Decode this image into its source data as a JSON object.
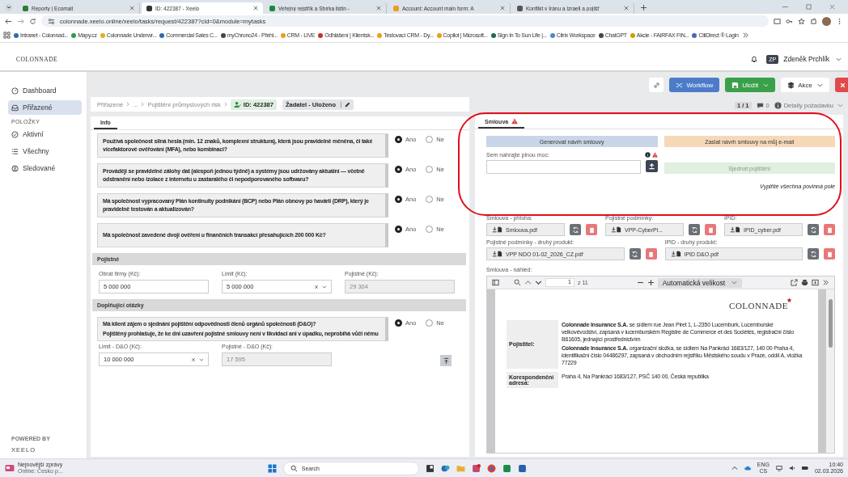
{
  "browser": {
    "tabs": [
      {
        "title": "Reporty | Ecomail",
        "color": "#2e7d32",
        "selected": false
      },
      {
        "title": "ID: 422387 - Xeelo",
        "color": "#333333",
        "selected": true
      },
      {
        "title": "Veřejný rejstřík a Sbírka listin - ",
        "color": "#1b8a3a",
        "selected": false
      },
      {
        "title": "Account: Account main form: A",
        "color": "#e8a020",
        "selected": false
      },
      {
        "title": "Konflikt v Íránu a Izraeli a pojišť",
        "color": "#555555",
        "selected": false
      }
    ],
    "url": "colonnade.xeelo.online/xeelo/tasks/request/422387?cid=0&module=mytasks",
    "bookmarks": [
      {
        "label": "Intranet - Colonnad...",
        "color": "#2a6db0"
      },
      {
        "label": "Mapy.cz",
        "color": "#2e9e4a"
      },
      {
        "label": "Colonnade Underwr...",
        "color": "#e0b020"
      },
      {
        "label": "Commercial Sales C...",
        "color": "#2a6db0"
      },
      {
        "label": "myChrono24 - Přehl...",
        "color": "#444444"
      },
      {
        "label": "CRM - LIVE",
        "color": "#e8a020"
      },
      {
        "label": "Odhlášení | Klientsk...",
        "color": "#c03030"
      },
      {
        "label": "Testovací CRM - Dy...",
        "color": "#e8a020"
      },
      {
        "label": "Copilot | Microsoft...",
        "color": "#e8a020"
      },
      {
        "label": "Sign In To Sun Life |...",
        "color": "#1a6a5a"
      },
      {
        "label": "Citrix Workspace",
        "color": "#4a8ad0"
      },
      {
        "label": "ChatGPT",
        "color": "#444444"
      },
      {
        "label": "Akcie - FAIRFAX FIN...",
        "color": "#c8a000"
      },
      {
        "label": "CitiDirect ® Login",
        "color": "#4a6ab0"
      }
    ]
  },
  "header": {
    "logo": "COLONNADE",
    "user_initials": "ZP",
    "user_name": "Zdeněk Prchlík"
  },
  "sidebar": {
    "items": [
      {
        "label": "Dashboard",
        "kind": "dashboard",
        "selected": false
      },
      {
        "label": "Přiřazené",
        "kind": "inbox",
        "selected": true
      }
    ],
    "section": "POLOŽKY",
    "section_items": [
      {
        "label": "Aktivní",
        "kind": "check",
        "selected": false
      },
      {
        "label": "Všechny",
        "kind": "list",
        "selected": false
      },
      {
        "label": "Sledované",
        "kind": "user",
        "selected": false
      }
    ],
    "powered_by": "POWERED BY",
    "brand": "XEELO"
  },
  "toolbar": {
    "buttons": [
      {
        "label": "Workflow",
        "kind": "workflow"
      },
      {
        "label": "Uložit",
        "kind": "save"
      },
      {
        "label": "Akce",
        "kind": "actions"
      }
    ]
  },
  "breadcrumb": {
    "items": [
      "Přiřazené",
      "...",
      "Pojištění průmyslových risk"
    ],
    "id": "ID: 422387",
    "status": "Žadatel - Uloženo"
  },
  "left_panel": {
    "tabs": [
      {
        "label": "Info",
        "selected": true
      }
    ],
    "questions": [
      {
        "paragraphs": [
          "Používá společnost silná hesla (min. 12 znaků, komplexní struktura), která jsou pravidelně měněna, či také vícefaktorové ověřování (MFA), nebo kombinaci?"
        ],
        "options": [
          {
            "label": "Ano",
            "selected": true
          },
          {
            "label": "Ne",
            "selected": false
          }
        ]
      },
      {
        "paragraphs": [
          "Provádějí se pravidelné zálohy dat (alespoň jednou týdně) a systémy jsou udržovány aktuální — včetně odstranění nebo izolace z internetu u zastaralého či nepodporovaného softwaru?"
        ],
        "options": [
          {
            "label": "Ano",
            "selected": true
          },
          {
            "label": "Ne",
            "selected": false
          }
        ]
      },
      {
        "paragraphs": [
          "Má společnost vypracovaný Plán kontinuity podnikání (BCP) nebo Plán obnovy po havárii (DRP), který je pravidelně testován a aktualizován?"
        ],
        "options": [
          {
            "label": "Ano",
            "selected": true
          },
          {
            "label": "Ne",
            "selected": false
          }
        ]
      },
      {
        "paragraphs": [
          "Má společnost zavedené dvojí ověření u finančních transakcí přesahujících 200 000 Kč?"
        ],
        "options": [
          {
            "label": "Ano",
            "selected": true
          },
          {
            "label": "Ne",
            "selected": false
          }
        ]
      }
    ],
    "premium": {
      "title": "Pojistné",
      "fields": [
        {
          "label": "Obrat firmy (Kč):",
          "value": "5 000 000",
          "kind": "input"
        },
        {
          "label": "Limit (Kč):",
          "value": "5 000 000",
          "kind": "select"
        },
        {
          "label": "Pojistné (Kč):",
          "value": "29 304",
          "kind": "readonly"
        }
      ]
    },
    "additional": {
      "title": "Doplňující otázky",
      "questions": [
        {
          "paragraphs": [
            "Má klient zájem o sjednání pojištění odpovědnosti členů orgánů společnosti (D&O)?",
            "Pojištěný prohlašuje, že ke dni uzavření pojistné smlouvy není v likvidaci ani v úpadku, neprobíhá vůči němu"
          ],
          "options": [
            {
              "label": "Ano",
              "selected": true
            },
            {
              "label": "Ne",
              "selected": false
            }
          ]
        }
      ],
      "fields": [
        {
          "label": "Limit - D&O (Kč):",
          "value": "10 000 000",
          "kind": "select"
        },
        {
          "label": "Pojistné - D&O (Kč):",
          "value": "17 595",
          "kind": "readonly"
        }
      ]
    }
  },
  "right_panel": {
    "counter": "1 / 1",
    "comments": "0",
    "details": "Detaily požadavku",
    "tabs": [
      {
        "label": "Smlouva",
        "warning": true,
        "selected": true
      }
    ],
    "generate": "Generovat návrh smlouvy",
    "send": "Zaslat návrh smlouvy na můj e-mail",
    "upload_label": "Sem nahrajte plnou moc:",
    "submit": {
      "label": "Sjednat pojištění",
      "disabled": true
    },
    "hint": "Vyplňte všechna povinná pole",
    "attachment_rows": [
      [
        {
          "label": "Smlouva - příloha:",
          "file": "Smlouva.pdf"
        },
        {
          "label": "Pojistné podmínky:",
          "file": "VPP-CyberPl..."
        },
        {
          "label": "IPID:",
          "file": "IPID_cyber.pdf"
        }
      ],
      [
        {
          "label": "Pojistné podmínky - druhý produkt:",
          "file": "VPP NDO 01-02_2026_CZ.pdf"
        },
        {
          "label": "IPID - druhý produkt:",
          "file": "IPID D&O.pdf"
        }
      ]
    ],
    "preview": {
      "label": "Smlouva - náhled:",
      "page": "1",
      "pages": "z 11",
      "zoom": "Automatická velikost",
      "logo": "COLONNADE",
      "rows": [
        {
          "label": "Pojistitel:",
          "paragraphs": [
            "**Colonnade Insurance S.A.** se sídlem rue Jean Piret 1, L-2350 Lucemburk, Lucemburské velkovévodství, zapsaná v lucemburském Registre de Commerce et des Sociétés, registrační číslo B61605, jednající prostřednictvím",
            "**Colonnade Insurance S.A.** organizační složka, se sídlem Na Pankráci 1683/127, 140 00 Praha 4, identifikační číslo 04486297, zapsaná v obchodním rejstříku Městského soudu v Praze, oddíl A, vložka 77229"
          ]
        },
        {
          "label": "Korespondenční adresa:",
          "paragraphs": [
            "Praha 4, Na Pankráci 1683/127, PSČ 140 00, Česká republika"
          ]
        }
      ]
    }
  },
  "taskbar": {
    "news_title": "Nejnovější zprávy",
    "news_sub": "Online: Česko p...",
    "search": "Search",
    "lang": "ENG",
    "layout": "CS",
    "time": "10:40",
    "date": "02.03.2026"
  }
}
